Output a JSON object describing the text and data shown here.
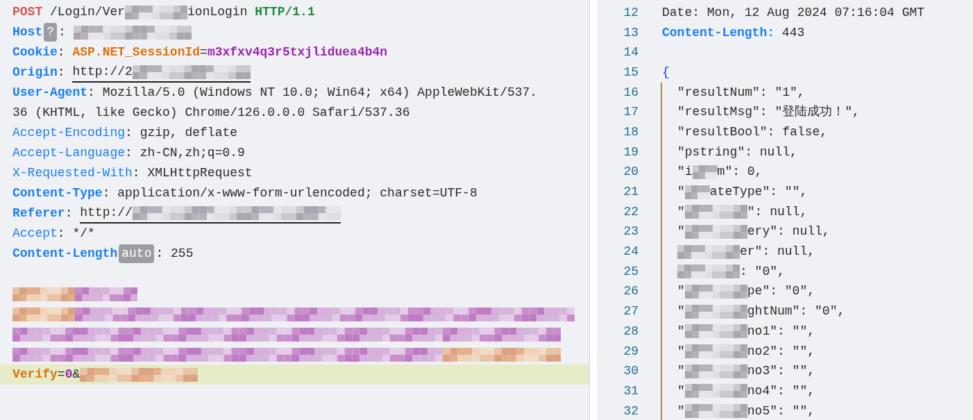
{
  "request": {
    "lines": [
      {
        "selected": false,
        "segments": [
          {
            "kind": "method",
            "text": "POST"
          },
          {
            "kind": "plain",
            "text": " /Login/Ver"
          },
          {
            "kind": "mask-s"
          },
          {
            "kind": "plain",
            "text": "ionLogin "
          },
          {
            "kind": "version",
            "text": "HTTP/1.1"
          }
        ]
      },
      {
        "selected": false,
        "segments": [
          {
            "kind": "header",
            "bold": true,
            "text": "Host"
          },
          {
            "kind": "badge",
            "text": "?"
          },
          {
            "kind": "plain",
            "text": ": "
          },
          {
            "kind": "mask-m"
          }
        ]
      },
      {
        "selected": false,
        "segments": [
          {
            "kind": "header",
            "bold": true,
            "text": "Cookie"
          },
          {
            "kind": "plain",
            "text": ": "
          },
          {
            "kind": "param-name",
            "text": "ASP.NET_SessionId"
          },
          {
            "kind": "plain",
            "text": "="
          },
          {
            "kind": "param-value",
            "text": "m3xfxv4q3r5txjliduea4b4n"
          }
        ]
      },
      {
        "selected": false,
        "segments": [
          {
            "kind": "header",
            "bold": true,
            "text": "Origin"
          },
          {
            "kind": "plain",
            "text": ": "
          },
          {
            "kind": "link",
            "parts": [
              {
                "kind": "plain",
                "text": "http://2"
              },
              {
                "kind": "mask-m"
              }
            ]
          }
        ]
      },
      {
        "selected": false,
        "segments": [
          {
            "kind": "header",
            "bold": true,
            "text": "User-Agent"
          },
          {
            "kind": "plain",
            "text": ": Mozilla/5.0 (Windows NT 10.0; Win64; x64) AppleWebKit/537."
          }
        ]
      },
      {
        "selected": false,
        "segments": [
          {
            "kind": "plain",
            "text": "36 (KHTML, like Gecko) Chrome/126.0.0.0 Safari/537.36"
          }
        ]
      },
      {
        "selected": false,
        "segments": [
          {
            "kind": "header",
            "bold": false,
            "text": "Accept-Encoding"
          },
          {
            "kind": "plain",
            "text": ": gzip, deflate"
          }
        ]
      },
      {
        "selected": false,
        "segments": [
          {
            "kind": "header",
            "bold": false,
            "text": "Accept-Language"
          },
          {
            "kind": "plain",
            "text": ": zh-CN,zh;q=0.9"
          }
        ]
      },
      {
        "selected": false,
        "segments": [
          {
            "kind": "header",
            "bold": false,
            "text": "X-Requested-With"
          },
          {
            "kind": "plain",
            "text": ": XMLHttpRequest"
          }
        ]
      },
      {
        "selected": false,
        "segments": [
          {
            "kind": "header",
            "bold": true,
            "text": "Content-Type"
          },
          {
            "kind": "plain",
            "text": ": application/x-www-form-urlencoded; charset=UTF-8"
          }
        ]
      },
      {
        "selected": false,
        "segments": [
          {
            "kind": "header",
            "bold": true,
            "text": "Referer"
          },
          {
            "kind": "plain",
            "text": ": "
          },
          {
            "kind": "link",
            "parts": [
              {
                "kind": "plain",
                "text": "http://"
              },
              {
                "kind": "mask-l"
              }
            ]
          }
        ]
      },
      {
        "selected": false,
        "segments": [
          {
            "kind": "header",
            "bold": false,
            "text": "Accept"
          },
          {
            "kind": "plain",
            "text": ": */*"
          }
        ]
      },
      {
        "selected": false,
        "segments": [
          {
            "kind": "header",
            "bold": true,
            "text": "Content-Length"
          },
          {
            "kind": "badge",
            "text": "auto"
          },
          {
            "kind": "plain",
            "text": ": 255"
          }
        ]
      },
      {
        "selected": false
      },
      {
        "selected": false,
        "segments": [
          {
            "kind": "stain-s"
          },
          {
            "kind": "smear-s"
          }
        ]
      },
      {
        "selected": false,
        "segments": [
          {
            "kind": "stain-s"
          },
          {
            "kind": "smear-xl"
          }
        ]
      },
      {
        "selected": false,
        "segments": [
          {
            "kind": "smear-w"
          },
          {
            "kind": "smear-m"
          }
        ]
      },
      {
        "selected": false,
        "segments": [
          {
            "kind": "smear-w"
          },
          {
            "kind": "stain-m"
          }
        ]
      },
      {
        "selected": true,
        "segments": [
          {
            "kind": "param-name",
            "text": "Verify"
          },
          {
            "kind": "plain",
            "text": "="
          },
          {
            "kind": "param-value",
            "text": "0"
          },
          {
            "kind": "plain",
            "text": "&"
          },
          {
            "kind": "stain-m"
          }
        ]
      }
    ]
  },
  "response": {
    "lines": [
      {
        "number": "12",
        "kind": "top",
        "segments": [
          {
            "kind": "plain",
            "text": "Date: Mon, 12 Aug 2024 07:16:04 GMT"
          }
        ]
      },
      {
        "number": "13",
        "kind": "top",
        "segments": [
          {
            "kind": "header",
            "bold": true,
            "text": "Content-Length:"
          },
          {
            "kind": "plain",
            "text": " 443"
          }
        ]
      },
      {
        "number": "14",
        "kind": "top"
      },
      {
        "number": "15",
        "kind": "top",
        "segments": [
          {
            "kind": "brace",
            "text": "{"
          }
        ]
      },
      {
        "number": "16",
        "kind": "nested",
        "segments": [
          {
            "kind": "plain",
            "text": "\"resultNum\": \"1\","
          }
        ]
      },
      {
        "number": "17",
        "kind": "nested",
        "segments": [
          {
            "kind": "plain",
            "text": "\"resultMsg\": \"登陆成功！\","
          }
        ]
      },
      {
        "number": "18",
        "kind": "nested",
        "segments": [
          {
            "kind": "plain",
            "text": "\"resultBool\": false,"
          }
        ]
      },
      {
        "number": "19",
        "kind": "nested",
        "segments": [
          {
            "kind": "plain",
            "text": "\"pstring\": null,"
          }
        ]
      },
      {
        "number": "20",
        "kind": "nested",
        "segments": [
          {
            "kind": "plain",
            "text": "\"i"
          },
          {
            "kind": "mask-xs"
          },
          {
            "kind": "plain",
            "text": "m\": 0,"
          }
        ]
      },
      {
        "number": "21",
        "kind": "nested",
        "segments": [
          {
            "kind": "plain",
            "text": "\""
          },
          {
            "kind": "mask-xs"
          },
          {
            "kind": "plain",
            "text": "ateType\": \"\","
          }
        ]
      },
      {
        "number": "22",
        "kind": "nested",
        "segments": [
          {
            "kind": "plain",
            "text": "\""
          },
          {
            "kind": "mask-s"
          },
          {
            "kind": "plain",
            "text": "\": null,"
          }
        ]
      },
      {
        "number": "23",
        "kind": "nested",
        "segments": [
          {
            "kind": "plain",
            "text": "\""
          },
          {
            "kind": "mask-s"
          },
          {
            "kind": "plain",
            "text": "ery\": null,"
          }
        ]
      },
      {
        "number": "24",
        "kind": "nested",
        "segments": [
          {
            "kind": "mask-s"
          },
          {
            "kind": "plain",
            "text": "er\": null,"
          }
        ]
      },
      {
        "number": "25",
        "kind": "nested",
        "segments": [
          {
            "kind": "mask-s"
          },
          {
            "kind": "plain",
            "text": ": \"0\","
          }
        ]
      },
      {
        "number": "26",
        "kind": "nested",
        "segments": [
          {
            "kind": "plain",
            "text": "\""
          },
          {
            "kind": "mask-s"
          },
          {
            "kind": "plain",
            "text": "pe\": \"0\","
          }
        ]
      },
      {
        "number": "27",
        "kind": "nested",
        "segments": [
          {
            "kind": "plain",
            "text": "\""
          },
          {
            "kind": "mask-s"
          },
          {
            "kind": "plain",
            "text": "ghtNum\": \"0\","
          }
        ]
      },
      {
        "number": "28",
        "kind": "nested",
        "segments": [
          {
            "kind": "plain",
            "text": "\""
          },
          {
            "kind": "mask-s"
          },
          {
            "kind": "plain",
            "text": "no1\": \"\","
          }
        ]
      },
      {
        "number": "29",
        "kind": "nested",
        "segments": [
          {
            "kind": "plain",
            "text": "\""
          },
          {
            "kind": "mask-s"
          },
          {
            "kind": "plain",
            "text": "no2\": \"\","
          }
        ]
      },
      {
        "number": "30",
        "kind": "nested",
        "segments": [
          {
            "kind": "plain",
            "text": "\""
          },
          {
            "kind": "mask-s"
          },
          {
            "kind": "plain",
            "text": "no3\": \"\","
          }
        ]
      },
      {
        "number": "31",
        "kind": "nested",
        "segments": [
          {
            "kind": "plain",
            "text": "\""
          },
          {
            "kind": "mask-s"
          },
          {
            "kind": "plain",
            "text": "no4\": \"\","
          }
        ]
      },
      {
        "number": "32",
        "kind": "nested",
        "segments": [
          {
            "kind": "plain",
            "text": "\""
          },
          {
            "kind": "mask-s"
          },
          {
            "kind": "plain",
            "text": "no5\": \"\","
          }
        ]
      }
    ]
  }
}
